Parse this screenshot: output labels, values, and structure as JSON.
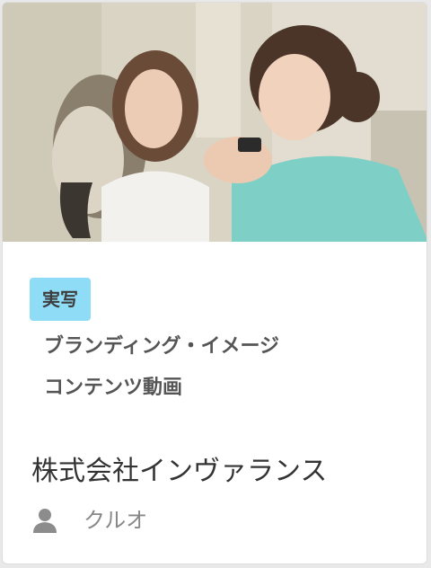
{
  "card": {
    "thumbnail_icon": "photo-two-women-and-cat",
    "tag": "実写",
    "categories": [
      "ブランディング・イメージ",
      "コンテンツ動画"
    ],
    "company": "株式会社インヴァランス",
    "author_icon": "user-icon",
    "author": "クルオ"
  },
  "colors": {
    "tag_background": "#8fdcf6",
    "company_text": "#333333",
    "author_text": "#888888"
  }
}
